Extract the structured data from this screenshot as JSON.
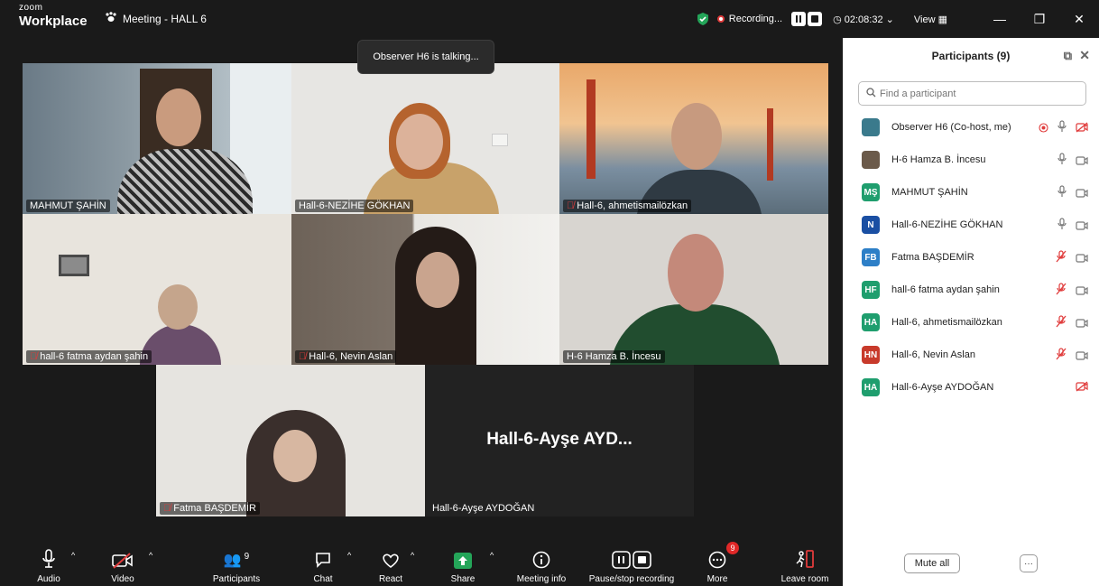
{
  "titlebar": {
    "brand_top": "zoom",
    "brand_bottom": "Workplace",
    "meeting_title": "Meeting - HALL 6",
    "recording_label": "Recording...",
    "timer": "02:08:32",
    "view_label": "View"
  },
  "toast": "Observer H6 is talking...",
  "tiles": [
    {
      "name": "MAHMUT ŞAHİN",
      "muted": false
    },
    {
      "name": "Hall-6-NEZİHE GÖKHAN",
      "muted": false
    },
    {
      "name": "Hall-6, ahmetismailözkan",
      "muted": true
    },
    {
      "name": "hall-6 fatma aydan şahin",
      "muted": true
    },
    {
      "name": "Hall-6, Nevin Aslan",
      "muted": true
    },
    {
      "name": "H-6 Hamza B. İncesu",
      "muted": false
    },
    {
      "name": "Fatma BAŞDEMİR",
      "muted": true
    },
    {
      "name": "Hall-6-Ayşe AYDOĞAN",
      "muted": false,
      "big_name": "Hall-6-Ayşe  AYD..."
    }
  ],
  "panel": {
    "title": "Participants (9)",
    "search_placeholder": "Find a participant",
    "participants": [
      {
        "name": "Observer H6 (Co-host, me)",
        "initials": "",
        "avatar_color": "#3a7a8c",
        "mic": "on",
        "cam": "off",
        "recording": true
      },
      {
        "name": "H-6 Hamza B. İncesu",
        "initials": "",
        "avatar_color": "#6b5a4a",
        "mic": "on",
        "cam": "on"
      },
      {
        "name": "MAHMUT ŞAHİN",
        "initials": "MŞ",
        "avatar_color": "#1f9e6e",
        "mic": "on",
        "cam": "on"
      },
      {
        "name": "Hall-6-NEZİHE GÖKHAN",
        "initials": "N",
        "avatar_color": "#1a4fa3",
        "mic": "on",
        "cam": "on"
      },
      {
        "name": "Fatma BAŞDEMİR",
        "initials": "FB",
        "avatar_color": "#2d7fc7",
        "mic": "muted",
        "cam": "on"
      },
      {
        "name": "hall-6 fatma aydan şahin",
        "initials": "HF",
        "avatar_color": "#1f9e6e",
        "mic": "muted",
        "cam": "on"
      },
      {
        "name": "Hall-6, ahmetismailözkan",
        "initials": "HA",
        "avatar_color": "#1f9e6e",
        "mic": "muted",
        "cam": "on"
      },
      {
        "name": "Hall-6, Nevin Aslan",
        "initials": "HN",
        "avatar_color": "#c83a2b",
        "mic": "muted",
        "cam": "on"
      },
      {
        "name": "Hall-6-Ayşe AYDOĞAN",
        "initials": "HA",
        "avatar_color": "#1f9e6e",
        "mic": "none",
        "cam": "off"
      }
    ],
    "mute_all": "Mute all",
    "more": "···"
  },
  "toolbar": {
    "audio": "Audio",
    "video": "Video",
    "participants": "Participants",
    "participants_count": "9",
    "chat": "Chat",
    "react": "React",
    "share": "Share",
    "meeting_info": "Meeting info",
    "pause_stop": "Pause/stop recording",
    "more": "More",
    "more_badge": "9",
    "leave": "Leave room"
  },
  "colors": {
    "accent_green": "#24a559",
    "muted_red": "#e03b3b",
    "badge_red": "#e02828"
  }
}
